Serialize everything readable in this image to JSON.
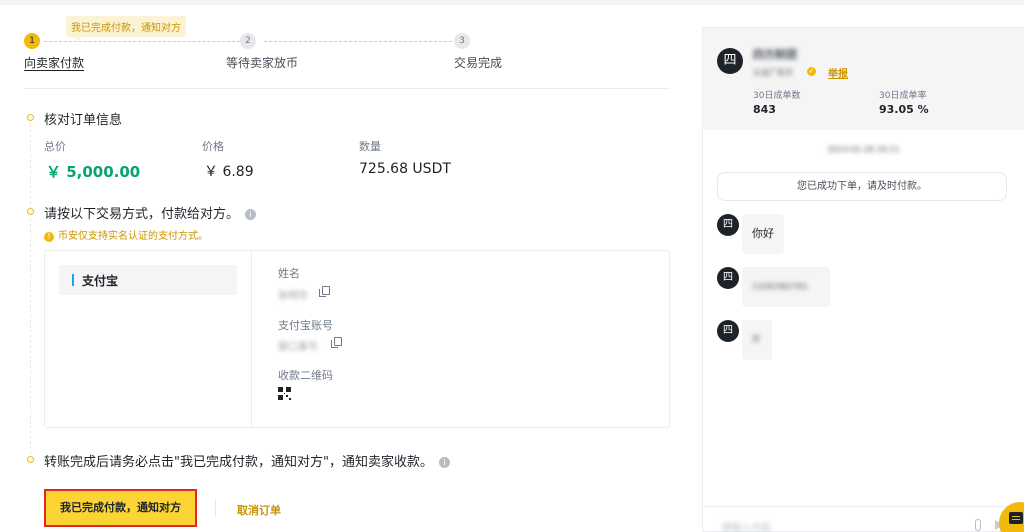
{
  "tooltip": "我已完成付款，通知对方",
  "steps": [
    {
      "num": "1",
      "label": "向卖家付款"
    },
    {
      "num": "2",
      "label": "等待卖家放币"
    },
    {
      "num": "3",
      "label": "交易完成"
    }
  ],
  "order": {
    "title": "核对订单信息",
    "total_label": "总价",
    "total_value": "￥ 5,000.00",
    "price_label": "价格",
    "price_value": "￥ 6.89",
    "qty_label": "数量",
    "qty_value": "725.68 USDT"
  },
  "payment": {
    "title": "请按以下交易方式，付款给对方。",
    "warning": "币安仅支持实名认证的支付方式。",
    "method": "支付宝",
    "name_label": "姓名",
    "name_value": "张明华",
    "account_label": "支付宝账号",
    "account_value": "窗口事号",
    "qr_label": "收款二维码"
  },
  "notice": "转账完成后请务必点击\"我已完成付款，通知对方\"，通知卖家收款。",
  "actions": {
    "confirm": "我已完成付款，通知对方",
    "cancel": "取消订单"
  },
  "chat": {
    "avatar_char": "四",
    "seller_name": "四方财团",
    "seller_sub": "认证广告方",
    "report": "举报",
    "stat1_label": "30日成单数",
    "stat1_value": "843",
    "stat2_label": "30日成单率",
    "stat2_value": "93.05 %",
    "date": "2023-01-28 20:11",
    "system_message": "您已成功下单，请及时付款。",
    "messages": [
      {
        "text": "你好"
      },
      {
        "text": "13282962761"
      },
      {
        "text": "开"
      }
    ],
    "input_placeholder": "请输入内容"
  },
  "colors": {
    "accent": "#f0b90b",
    "green": "#03a66d",
    "link": "#c99400"
  }
}
